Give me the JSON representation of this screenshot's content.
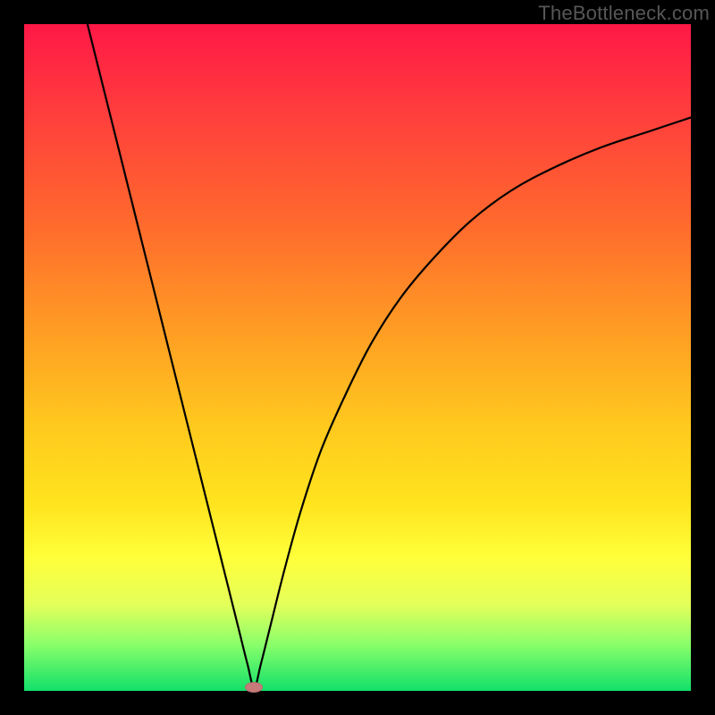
{
  "watermark": "TheBottleneck.com",
  "colors": {
    "frame": "#000000",
    "curve": "#000000",
    "marker": "#c77a7a",
    "gradient_stops": [
      "#ff1846",
      "#ff3a3e",
      "#ff6a2d",
      "#ff9a24",
      "#ffc81e",
      "#ffe41e",
      "#ffff3a",
      "#e4ff5a",
      "#8aff6a",
      "#12e06a"
    ]
  },
  "chart_data": {
    "type": "line",
    "title": "",
    "xlabel": "",
    "ylabel": "",
    "xlim": [
      0,
      100
    ],
    "ylim": [
      0,
      100
    ],
    "annotations": [
      {
        "name": "minimum-marker",
        "x": 34.5,
        "y": 0.5
      }
    ],
    "series": [
      {
        "name": "bottleneck-curve",
        "x": [
          9.5,
          12,
          14.5,
          17,
          19.5,
          22,
          24.5,
          27,
          29.5,
          32,
          33.5,
          34.5,
          35.5,
          37,
          39,
          41.5,
          44.5,
          48,
          52,
          56.5,
          61.5,
          67,
          73,
          79.5,
          86.5,
          94,
          100
        ],
        "y": [
          100,
          90,
          80,
          70,
          60,
          50,
          40,
          30,
          20,
          10,
          4,
          0.5,
          4,
          10,
          18,
          27,
          36,
          44,
          52,
          59,
          65,
          70.5,
          75,
          78.5,
          81.5,
          84,
          86
        ]
      }
    ]
  }
}
